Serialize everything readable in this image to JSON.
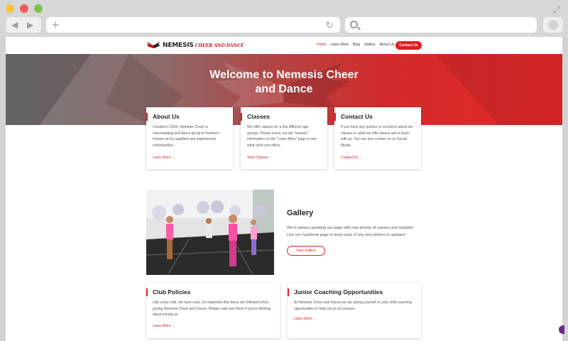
{
  "browser": {
    "address_value": "",
    "search_value": ""
  },
  "nav": {
    "logo_name": "NEMESIS",
    "logo_tagline": "CHEER AND DANCE",
    "items": [
      "Home",
      "Learn More",
      "Blog",
      "Gallery",
      "About Us"
    ],
    "active_index": 0,
    "cta_label": "Contact Us"
  },
  "hero": {
    "title_line1": "Welcome to Nemesis Cheer",
    "title_line2": "and Dance"
  },
  "cards": [
    {
      "title": "About Us",
      "lines": [
        "Created in 2020, Nemesis Cheer is",
        "cheerleading and dance group in Northern",
        "Ireland run by qualified and experienced",
        "cheerleaders."
      ],
      "link": "Learn More →"
    },
    {
      "title": "Classes",
      "lines": [
        "We offer classes for a few different age",
        "groups. Please check out our \"classes\"",
        "information on the \"Learn More\" page to see",
        "what each one offers."
      ],
      "link": "View Classes →"
    },
    {
      "title": "Contact Us",
      "lines": [
        "If you have any queries or concerns about our",
        "classes or what we offer please get in touch",
        "with us. You can also contact us on Social",
        "Media."
      ],
      "link": "Contact Us →"
    }
  ],
  "gallery": {
    "title": "Gallery",
    "lines": [
      "We're always updating our page with new photos of classes and updates!",
      "Like our Facebook page to keep track of any new photos or updates!"
    ],
    "button": "View Gallery"
  },
  "bottom_cards": [
    {
      "title": "Club Policies",
      "lines": [
        "Like every club, we have rules. It's important that these are followed when",
        "joining Nemesis Cheer and Dance. Please read over them if you're thinking",
        "about joining us."
      ],
      "link": "Learn More →"
    },
    {
      "title": "Junior Coaching Opportunities",
      "lines": [
        "At Nemesis Cheer and Dance we are giving yourself or your child coaching",
        "opportunities to help out at our classes."
      ],
      "link": "Learn More →"
    }
  ],
  "colors": {
    "accent": "#e3201d",
    "hero_left": "#7a7a7a",
    "hero_right": "#e32828"
  }
}
